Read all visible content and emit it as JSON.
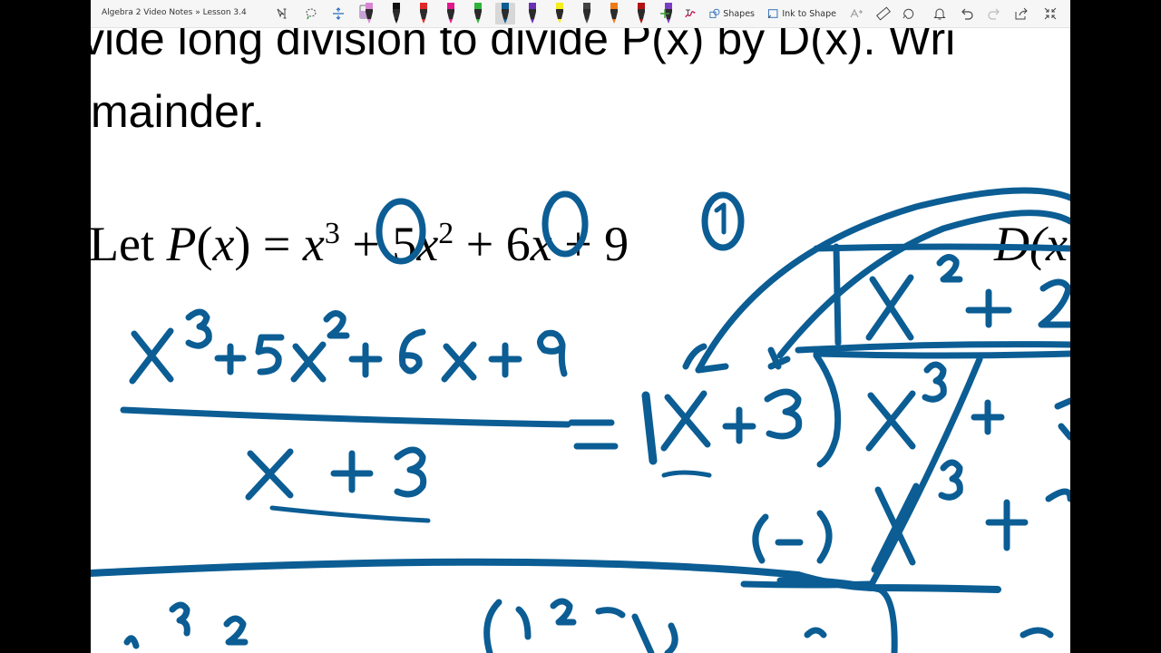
{
  "toolbar": {
    "breadcrumb": "Algebra 2 Video Notes » Lesson 3.4",
    "shapes_label": "Shapes",
    "ink_to_shape_label": "Ink to Shape",
    "pens": [
      {
        "icon": "pen-pink-icon",
        "color": "#d985d2"
      },
      {
        "icon": "pen-black-icon",
        "color": "#111111"
      },
      {
        "icon": "pen-red-icon",
        "color": "#e02828"
      },
      {
        "icon": "pen-magenta-icon",
        "color": "#e1188d"
      },
      {
        "icon": "pen-green-icon",
        "color": "#2fb339"
      },
      {
        "icon": "pen-blue-icon",
        "color": "#0b5d94"
      },
      {
        "icon": "pen-purple-icon",
        "color": "#6b2fb3"
      },
      {
        "icon": "highlighter-yellow-icon",
        "color": "#f7ec1e"
      },
      {
        "icon": "pen-galaxy-icon",
        "color": "#444444"
      },
      {
        "icon": "pen-orange-icon",
        "color": "#f07a16"
      },
      {
        "icon": "pen-darkred-icon",
        "color": "#b31212"
      },
      {
        "icon": "pen-violet-icon",
        "color": "#7a3dc4"
      }
    ]
  },
  "content": {
    "line1": "vide long division to divide P(x) by D(x). Wri",
    "line2": "mainder.",
    "formula": {
      "lead": "Let ",
      "p": "P",
      "paren_open": "(",
      "x": "x",
      "paren_close": ")",
      "eq": " = ",
      "x1": "x",
      "exp3": "3",
      "plus1": " + 5",
      "x2": "x",
      "exp2": "2",
      "plus2": " + 6",
      "x3": "x",
      "plus3": " + 9",
      "d_partial": "D(x"
    }
  },
  "ink": {
    "color": "#0b5d94"
  }
}
